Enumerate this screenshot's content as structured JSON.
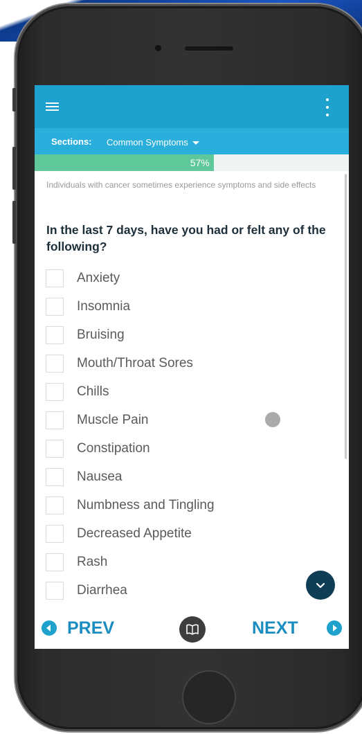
{
  "app": {
    "sections_label": "Sections:",
    "section_selected": "Common Symptoms",
    "progress_percent": 57,
    "progress_text": "57%"
  },
  "survey": {
    "intro": "Individuals with cancer sometimes experience symptoms and side effects",
    "question": "In the last 7 days, have you had or felt any of the following?",
    "options": [
      {
        "label": "Anxiety",
        "checked": false
      },
      {
        "label": "Insomnia",
        "checked": false
      },
      {
        "label": "Bruising",
        "checked": false
      },
      {
        "label": "Mouth/Throat Sores",
        "checked": false
      },
      {
        "label": "Chills",
        "checked": false
      },
      {
        "label": "Muscle Pain",
        "checked": false
      },
      {
        "label": "Constipation",
        "checked": false
      },
      {
        "label": "Nausea",
        "checked": false
      },
      {
        "label": "Numbness and Tingling",
        "checked": false
      },
      {
        "label": "Decreased Appetite",
        "checked": false
      },
      {
        "label": "Rash",
        "checked": false
      },
      {
        "label": "Diarrhea",
        "checked": false
      }
    ]
  },
  "nav": {
    "prev_label": "PREV",
    "next_label": "NEXT"
  },
  "icons": {
    "menu": "hamburger-menu-icon",
    "more": "kebab-more-icon",
    "dropdown": "caret-down-icon",
    "scroll_down": "chevron-down-icon",
    "prev": "arrow-left-circle-icon",
    "next": "arrow-right-circle-icon",
    "book": "open-book-icon"
  },
  "colors": {
    "topbar": "#1fa1ce",
    "sections_bar": "#2aaedb",
    "progress_fill": "#5ec89a",
    "nav_text": "#1a8cc0",
    "fab": "#0e3d55"
  }
}
